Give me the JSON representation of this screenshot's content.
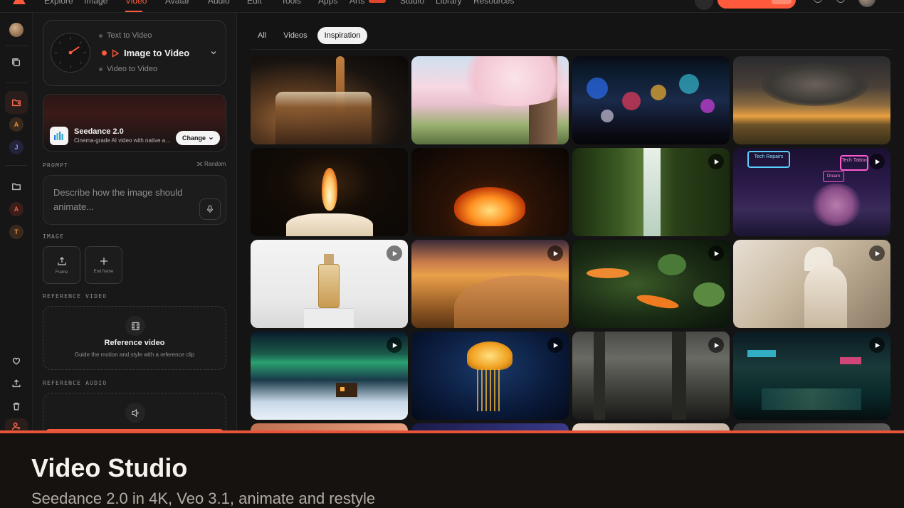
{
  "nav": {
    "items": [
      "Explore",
      "Image",
      "Video",
      "Avatar",
      "Audio",
      "Edit",
      "Tools",
      "Apps",
      "Arts",
      "Studio",
      "Library",
      "Resources"
    ],
    "active": "Video"
  },
  "rail": {
    "avatars": [
      {
        "letter": "A",
        "color": "#e8923a"
      },
      {
        "letter": "J",
        "color": "#7f7ff0"
      },
      {
        "letter": "A",
        "color": "#ef5b45"
      },
      {
        "letter": "T",
        "color": "#e8923a"
      }
    ]
  },
  "mode": {
    "options": [
      "Text to Video",
      "Image to Video",
      "Video to Video"
    ],
    "selected": "Image to Video"
  },
  "model": {
    "name": "Seedance 2.0",
    "description": "Cinema-grade AI video with native audio",
    "change_label": "Change"
  },
  "prompt": {
    "label": "PROMPT",
    "random_label": "Random",
    "placeholder": "Describe how the image should animate..."
  },
  "image": {
    "label": "IMAGE",
    "slots": [
      "Frame",
      "End frame"
    ]
  },
  "reference_video": {
    "label": "REFERENCE VIDEO",
    "title": "Reference video",
    "subtitle": "Guide the motion and style with a reference clip"
  },
  "reference_audio": {
    "label": "REFERENCE AUDIO"
  },
  "tabs": [
    "All",
    "Videos",
    "Inspiration"
  ],
  "active_tab": "Inspiration",
  "gallery": [
    {
      "name": "coffee-pour",
      "play": false
    },
    {
      "name": "cherry-blossom",
      "play": false
    },
    {
      "name": "rainy-window-bokeh",
      "play": false
    },
    {
      "name": "storm-supercell",
      "play": false
    },
    {
      "name": "candle-flame",
      "play": false
    },
    {
      "name": "campfire",
      "play": false
    },
    {
      "name": "forest-waterfall",
      "play": true
    },
    {
      "name": "neon-alley",
      "play": true,
      "signs": [
        "Tech Repairs",
        "Tech Tattoo",
        "Dream"
      ]
    },
    {
      "name": "perfume-bottle",
      "play": true
    },
    {
      "name": "desert-dunes",
      "play": true
    },
    {
      "name": "koi-pond",
      "play": true
    },
    {
      "name": "marble-statue",
      "play": true
    },
    {
      "name": "aurora-cabin",
      "play": true
    },
    {
      "name": "jellyfish",
      "play": true
    },
    {
      "name": "misty-forest",
      "play": true
    },
    {
      "name": "neon-street-night",
      "play": true
    }
  ],
  "footer": {
    "title": "Video Studio",
    "subtitle": "Seedance 2.0 in 4K, Veo 3.1, animate and restyle"
  },
  "colors": {
    "accent": "#ff5a3c",
    "background": "#141414",
    "footer_bg": "#16120f"
  }
}
